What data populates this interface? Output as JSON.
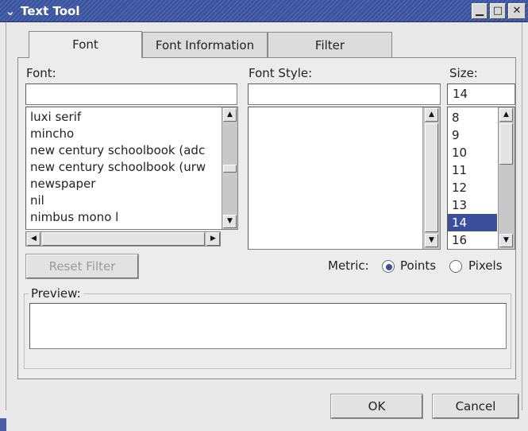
{
  "window": {
    "title": "Text Tool",
    "menu_glyph": "⌄",
    "minimize_glyph": "▁",
    "maximize_glyph": "□",
    "close_glyph": "✕"
  },
  "tabs": [
    {
      "label": "Font",
      "active": true
    },
    {
      "label": "Font Information",
      "active": false
    },
    {
      "label": "Filter",
      "active": false
    }
  ],
  "font": {
    "label": "Font:",
    "value": "",
    "items": [
      "luxi serif",
      "mincho",
      "new century schoolbook (adc",
      "new century schoolbook (urw",
      "newspaper",
      "nil",
      "nimbus mono l"
    ]
  },
  "font_style": {
    "label": "Font Style:",
    "value": "",
    "items": []
  },
  "size": {
    "label": "Size:",
    "value": "14",
    "items": [
      "8",
      "9",
      "10",
      "11",
      "12",
      "13",
      "14",
      "16"
    ],
    "selected": "14"
  },
  "reset_filter": {
    "label": "Reset Filter"
  },
  "metric": {
    "label": "Metric:",
    "options": [
      {
        "label": "Points",
        "selected": true
      },
      {
        "label": "Pixels",
        "selected": false
      }
    ]
  },
  "preview": {
    "label": "Preview:",
    "text": ""
  },
  "buttons": {
    "ok": "OK",
    "cancel": "Cancel"
  },
  "colors": {
    "titlebar": "#3b54a0",
    "selection": "#3c4f9c",
    "background": "#ececec"
  },
  "icons": {
    "scroll_up": "▲",
    "scroll_down": "▼",
    "scroll_left": "◀",
    "scroll_right": "▶"
  }
}
